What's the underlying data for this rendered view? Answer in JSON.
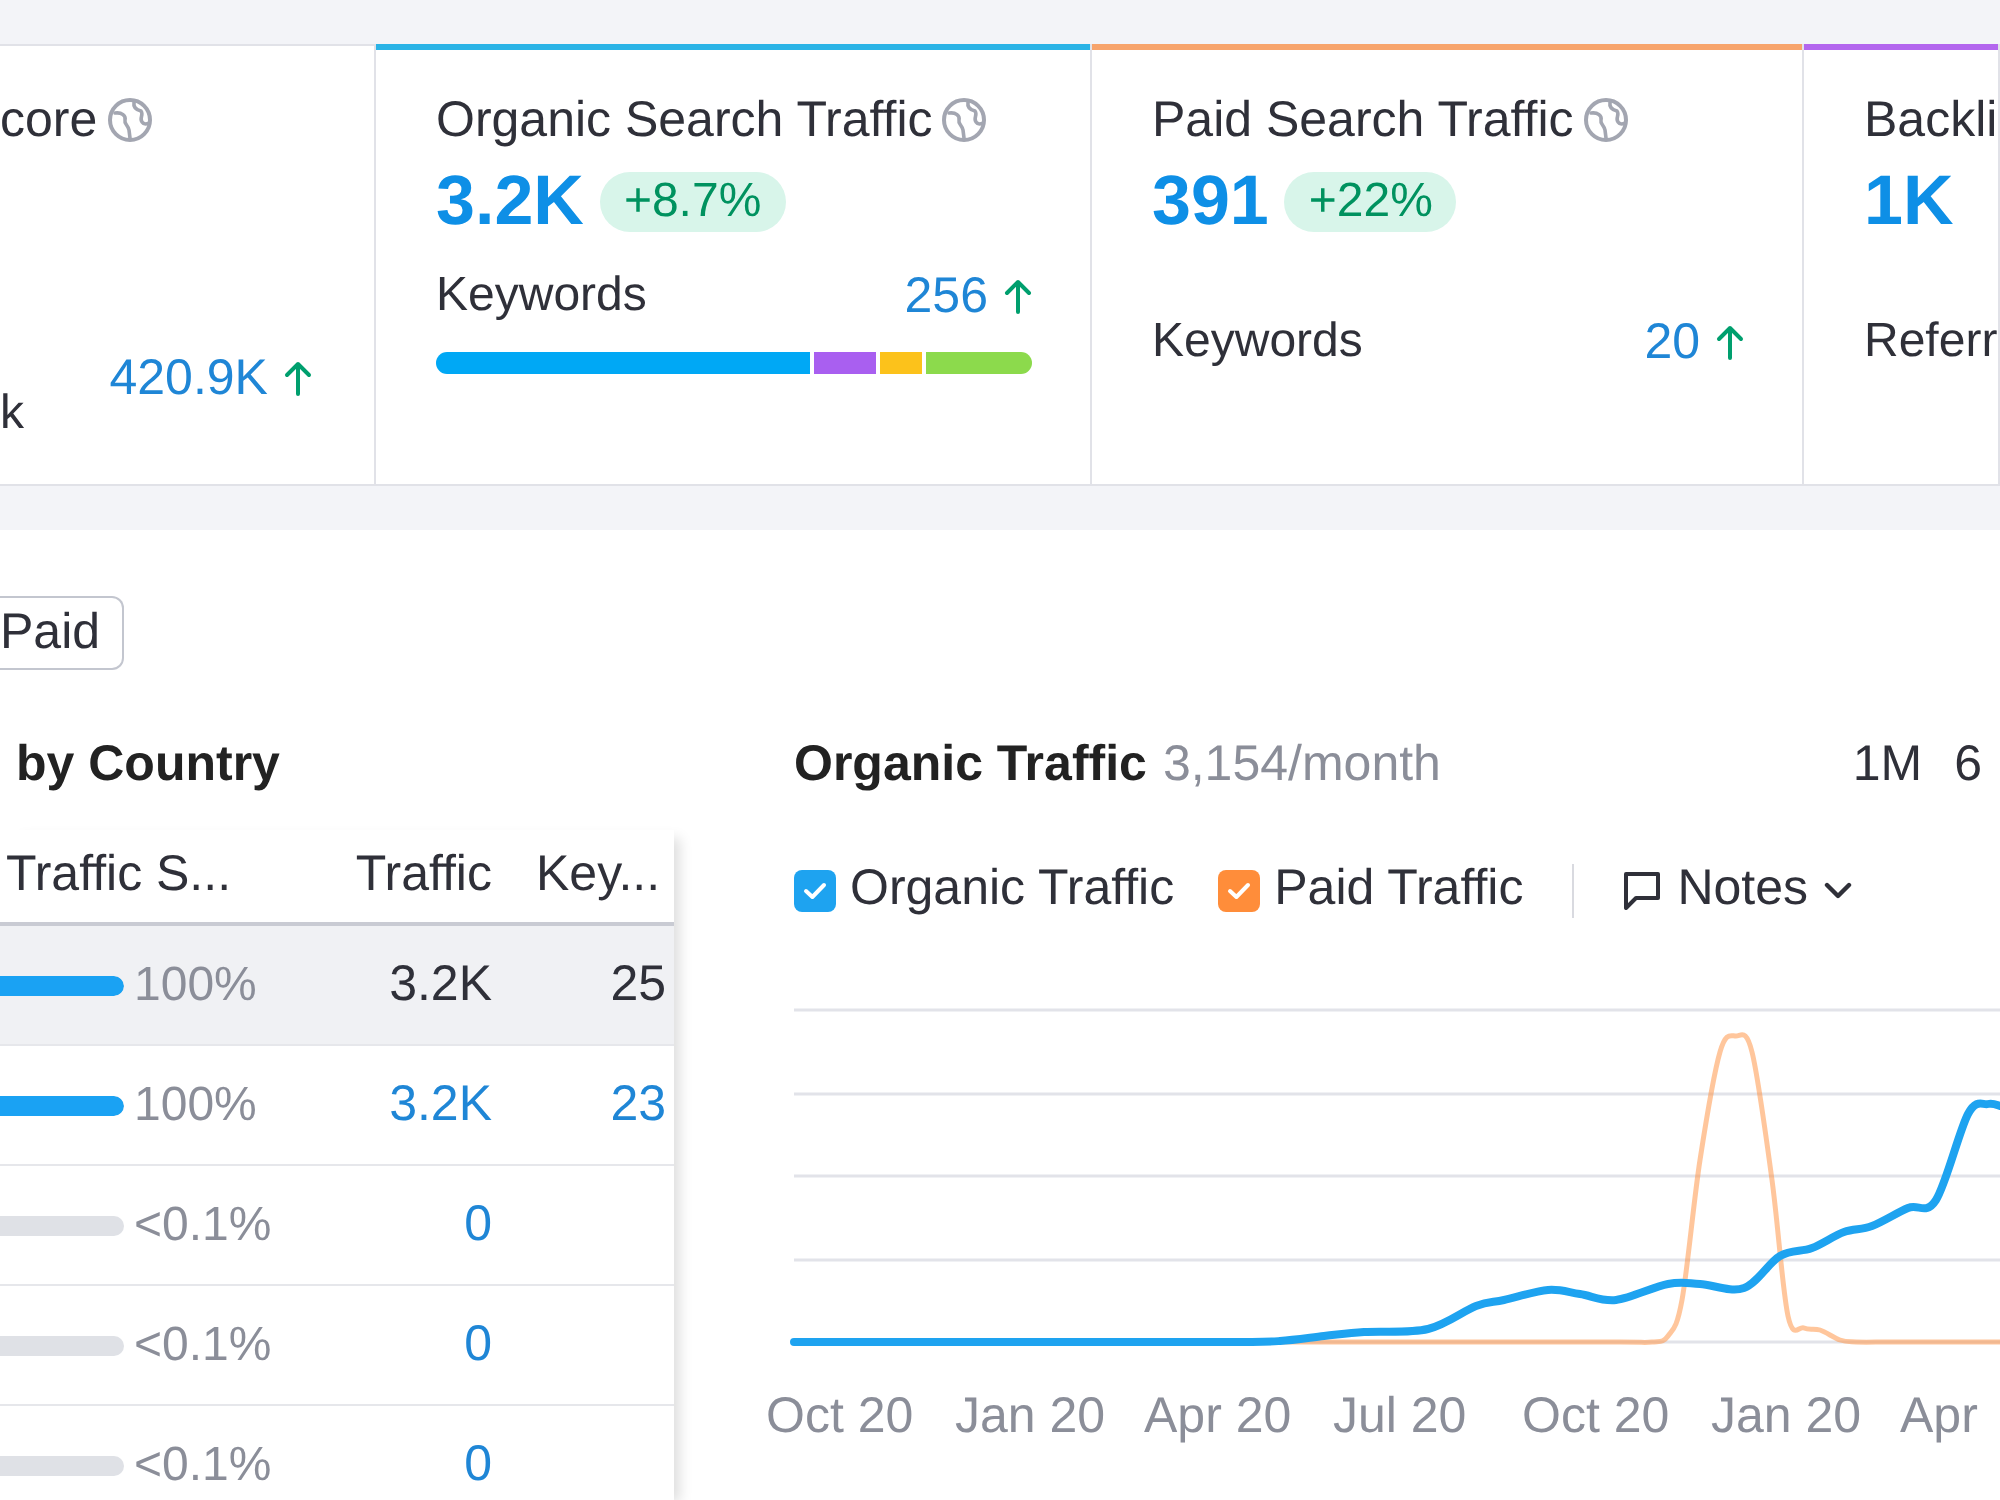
{
  "cards": [
    {
      "title": "core",
      "info_icon": true,
      "sub_label": "k",
      "sub_value": "420.9K"
    },
    {
      "title": "Organic Search Traffic",
      "info_icon": true,
      "color": "#2ab3e6",
      "value": "3.2K",
      "change": "+8.7%",
      "sub_label": "Keywords",
      "sub_value": "256",
      "breakdown_bar": true
    },
    {
      "title": "Paid Search Traffic",
      "info_icon": true,
      "color": "#f7a46c",
      "value": "391",
      "change": "+22%",
      "sub_label": "Keywords",
      "sub_value": "20"
    },
    {
      "title": "Backli",
      "color": "#b366ee",
      "value": "1K",
      "sub_label": "Referr"
    }
  ],
  "filter_button": {
    "label": "Paid"
  },
  "country_table": {
    "title": "by Country",
    "columns": [
      "Traffic S...",
      "Traffic",
      "Key..."
    ],
    "rows": [
      {
        "share": "100%",
        "level": 1,
        "traffic": "3.2K",
        "keywords": "25",
        "selected": true
      },
      {
        "share": "100%",
        "level": 1,
        "traffic": "3.2K",
        "keywords": "23",
        "selected": false
      },
      {
        "share": "<0.1%",
        "level": 0,
        "traffic": "0",
        "selected": false
      },
      {
        "share": "<0.1%",
        "level": 0,
        "traffic": "0",
        "selected": false
      },
      {
        "share": "<0.1%",
        "level": 0,
        "traffic": "0",
        "selected": false
      }
    ]
  },
  "chart": {
    "title": "Organic Traffic",
    "subtitle": "3,154/month",
    "periods": [
      {
        "label": "1M",
        "selected": false
      },
      {
        "label": "6",
        "selected": false
      }
    ],
    "legend": [
      {
        "label": "Organic Traffic",
        "checked": true,
        "color": "#1ea3f0"
      },
      {
        "label": "Paid Traffic",
        "checked": true,
        "color": "#ff8d3a"
      }
    ],
    "notes_button": "Notes",
    "x_axis_labels": [
      "Oct 20",
      "Jan 20",
      "Apr 20",
      "Jul 20",
      "Oct 20",
      "Jan 20",
      "Apr"
    ]
  }
}
